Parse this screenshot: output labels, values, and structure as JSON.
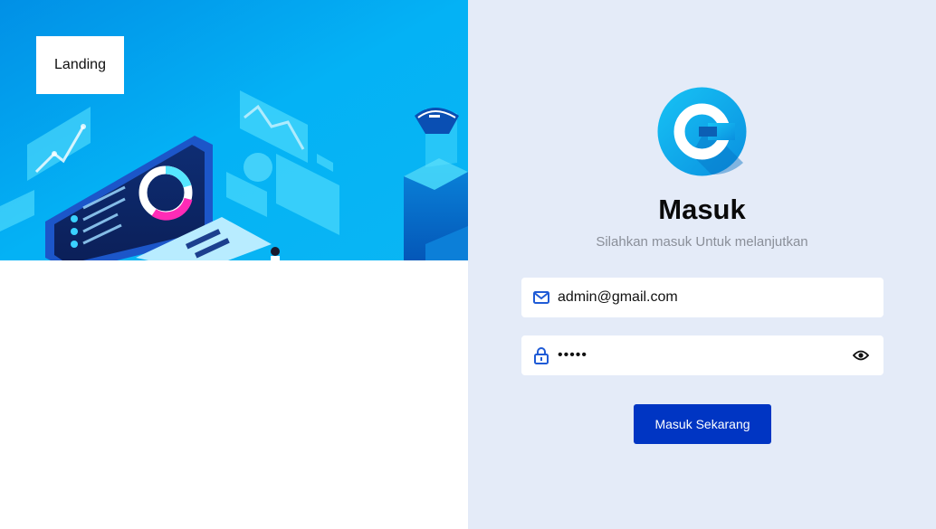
{
  "hero": {
    "landing_label": "Landing"
  },
  "login": {
    "title": "Masuk",
    "subtitle": "Silahkan masuk Untuk melanjutkan",
    "email": {
      "value": "admin@gmail.com",
      "icon": "mail-icon"
    },
    "password": {
      "value": "•••••",
      "icon": "lock-icon",
      "toggle_icon": "eye-icon"
    },
    "submit_label": "Masuk Sekarang"
  },
  "colors": {
    "accent": "#0035c3",
    "right_background": "#e4ebf8",
    "hero_background": "#00a8f0",
    "icon_blue": "#1f5bd6"
  }
}
